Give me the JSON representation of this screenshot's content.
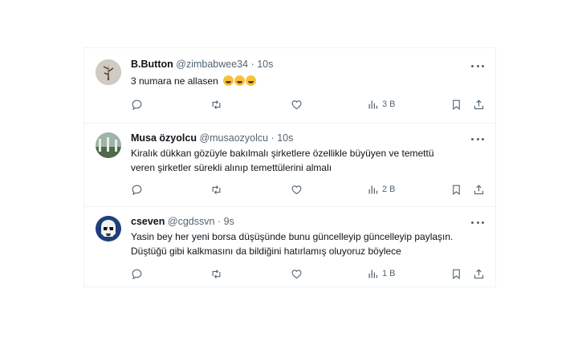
{
  "tweets": [
    {
      "name": "B.Button",
      "handle": "@zimbabwee34",
      "separator": "·",
      "time": "10s",
      "lines": [
        "3 numara ne allasen"
      ],
      "emoji": "😂😂😂",
      "views": "3 B",
      "avatar_icon": "tree-avatar"
    },
    {
      "name": "Musa özyolcu",
      "handle": "@musaozyolcu",
      "separator": "·",
      "time": "10s",
      "lines": [
        "Kiralık dükkan gözüyle bakılmalı şirketlere özellikle büyüyen ve temettü",
        "veren şirketler sürekli alınıp temettülerini almalı"
      ],
      "views": "2 B",
      "avatar_icon": "landscape-avatar"
    },
    {
      "name": "cseven",
      "handle": "@cgdssvn",
      "separator": "·",
      "time": "9s",
      "lines": [
        "Yasin bey her yeni borsa düşüşünde bunu güncelleyip güncelleyip paylaşın.",
        "Düştüğü gibi kalkmasını da bildiğini hatırlamış oluyoruz böylece"
      ],
      "views": "1 B",
      "avatar_icon": "stormtrooper-avatar"
    }
  ],
  "colors": {
    "muted": "#536471",
    "text": "#0f1419",
    "border": "#eff3f4"
  }
}
